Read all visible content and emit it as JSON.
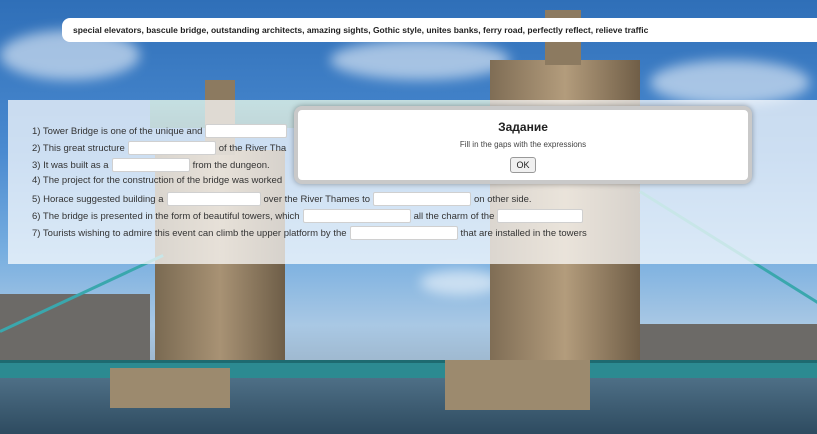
{
  "word_bank": "special elevators, bascule bridge, outstanding architects, amazing sights, Gothic style, unites banks, ferry road, perfectly reflect, relieve traffic",
  "sentences": [
    {
      "before": "1) Tower Bridge is one of the unique and",
      "middle": "",
      "after": ""
    },
    {
      "before": "2) This great structure",
      "middle": "of the River Tha",
      "after": ""
    },
    {
      "before": "3) It was built as a",
      "middle": "from the dungeon.",
      "after": ""
    },
    {
      "before": "4) The project for the construction of the bridge was worked",
      "middle": "",
      "after": ""
    },
    {
      "before": "5) Horace suggested building a",
      "middle": "over the River Thames to",
      "after": "on other side."
    },
    {
      "before": "6) The bridge is presented in the form of beautiful towers, which",
      "middle": "all the charm of the",
      "after": ""
    },
    {
      "before": "7) Tourists wishing to admire this event can climb the upper platform by the",
      "middle": "that are installed in the towers",
      "after": ""
    }
  ],
  "modal": {
    "title": "Задание",
    "message": "Fill in the gaps with the expressions",
    "ok_label": "OK"
  }
}
